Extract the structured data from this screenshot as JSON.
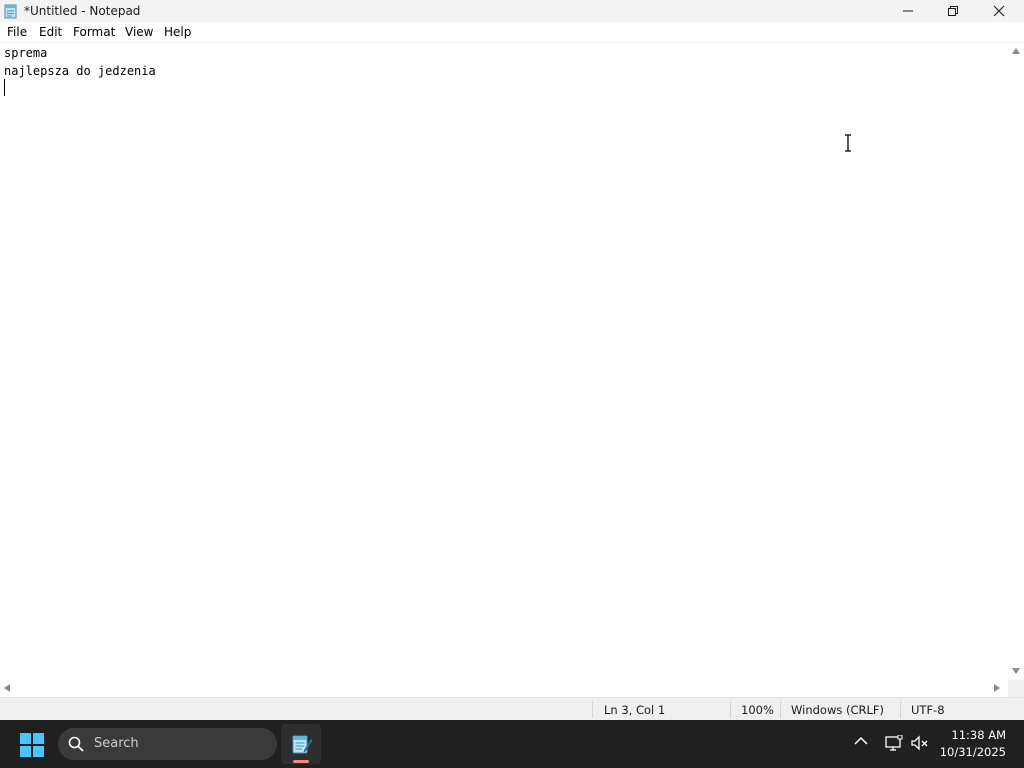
{
  "window": {
    "title": "*Untitled - Notepad",
    "app_icon": "notepad-icon",
    "controls": {
      "minimize_icon": "minimize-icon",
      "maximize_icon": "restore-icon",
      "close_icon": "close-icon"
    }
  },
  "menu": {
    "items": [
      "File",
      "Edit",
      "Format",
      "View",
      "Help"
    ]
  },
  "editor": {
    "lines": [
      "sprema",
      "najlepsza do jedzenia",
      ""
    ],
    "caret_line": 3,
    "caret_col": 1
  },
  "status": {
    "position": "Ln 3, Col 1",
    "zoom": "100%",
    "line_ending": "Windows (CRLF)",
    "encoding": "UTF-8"
  },
  "taskbar": {
    "start_icon": "windows-start-icon",
    "search_label": "Search",
    "pinned_app_icon": "notepad-icon",
    "tray": {
      "chevron_icon": "chevron-up-icon",
      "network_icon": "network-icon",
      "volume_icon": "volume-muted-icon"
    },
    "clock": {
      "time": "11:38 AM",
      "date": "10/31/2025"
    }
  },
  "colors": {
    "taskbar_bg": "#202020",
    "titlebar_bg": "#f3f3f3",
    "statusbar_bg": "#f0f0f0",
    "active_indicator": "#f08a7a"
  }
}
